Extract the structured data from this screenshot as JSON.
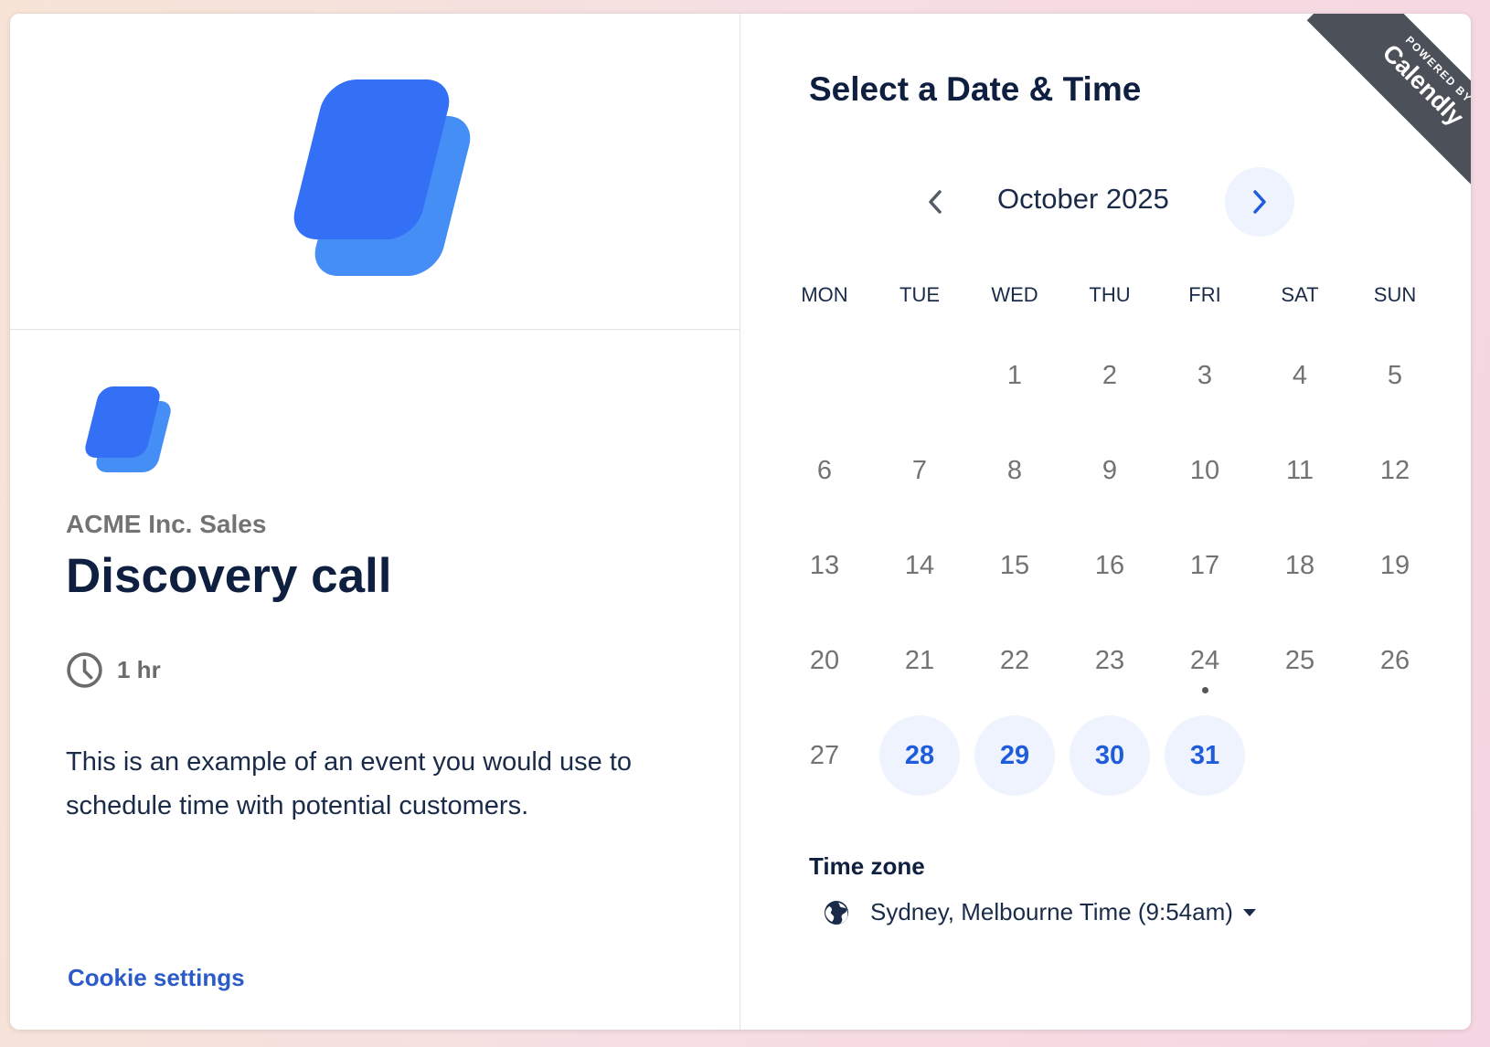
{
  "event": {
    "organization": "ACME Inc. Sales",
    "title": "Discovery call",
    "duration": "1 hr",
    "description": "This is an example of an event you would use to schedule time with potential customers.",
    "cookie_settings": "Cookie settings"
  },
  "scheduler": {
    "title": "Select a Date & Time",
    "month_label": "October 2025",
    "weekdays": [
      "MON",
      "TUE",
      "WED",
      "THU",
      "FRI",
      "SAT",
      "SUN"
    ],
    "days": [
      {
        "label": "",
        "available": false
      },
      {
        "label": "",
        "available": false
      },
      {
        "label": "1",
        "available": false
      },
      {
        "label": "2",
        "available": false
      },
      {
        "label": "3",
        "available": false
      },
      {
        "label": "4",
        "available": false
      },
      {
        "label": "5",
        "available": false
      },
      {
        "label": "6",
        "available": false
      },
      {
        "label": "7",
        "available": false
      },
      {
        "label": "8",
        "available": false
      },
      {
        "label": "9",
        "available": false
      },
      {
        "label": "10",
        "available": false
      },
      {
        "label": "11",
        "available": false
      },
      {
        "label": "12",
        "available": false
      },
      {
        "label": "13",
        "available": false
      },
      {
        "label": "14",
        "available": false
      },
      {
        "label": "15",
        "available": false
      },
      {
        "label": "16",
        "available": false
      },
      {
        "label": "17",
        "available": false
      },
      {
        "label": "18",
        "available": false
      },
      {
        "label": "19",
        "available": false
      },
      {
        "label": "20",
        "available": false
      },
      {
        "label": "21",
        "available": false
      },
      {
        "label": "22",
        "available": false
      },
      {
        "label": "23",
        "available": false
      },
      {
        "label": "24",
        "available": false,
        "today": true
      },
      {
        "label": "25",
        "available": false
      },
      {
        "label": "26",
        "available": false
      },
      {
        "label": "27",
        "available": false
      },
      {
        "label": "28",
        "available": true
      },
      {
        "label": "29",
        "available": true
      },
      {
        "label": "30",
        "available": true
      },
      {
        "label": "31",
        "available": true
      }
    ],
    "timezone_label": "Time zone",
    "timezone_value": "Sydney, Melbourne Time (9:54am)"
  },
  "badge": {
    "top": "POWERED BY",
    "brand": "Calendly"
  },
  "colors": {
    "accent": "#1f5cdc",
    "available_bg": "#eef3fd",
    "logo_front": "#3370f5",
    "logo_back": "#458ef6",
    "badge_bg": "#4b5059"
  },
  "icons": {
    "duration": "clock-icon",
    "timezone": "globe-icon",
    "prev": "chevron-left-icon",
    "next": "chevron-right-icon",
    "timezone_dropdown": "caret-down-icon"
  }
}
